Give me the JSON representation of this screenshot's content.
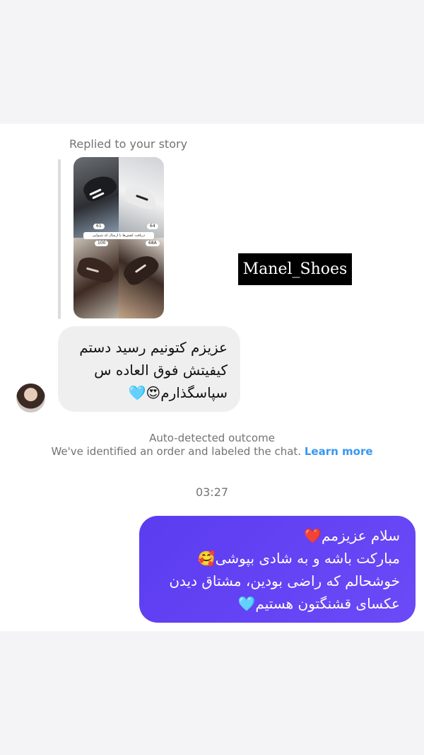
{
  "story_reply": {
    "label": "Replied to your story",
    "story_caption": "دریافت کفش‌ها با ارسال کد شنوایی",
    "tags": [
      "61",
      "64",
      "100",
      "68A"
    ]
  },
  "watermark": "Manel_Shoes",
  "incoming_message": {
    "lines": [
      "عزیزم کتونیم رسید دستم",
      "کیفیتش فوق العاده س",
      "سپاسگذارم😍🩵"
    ]
  },
  "outcome_notice": {
    "title": "Auto-detected outcome",
    "description": "We've identified an order and labeled the chat.",
    "link": "Learn more"
  },
  "timestamp": "03:27",
  "outgoing_message": {
    "lines": [
      "سلام عزیزمم❤️",
      "مبارکت باشه و به شادی بپوشی🥰",
      "خوشحالم که راضی بودین، مشتاق دیدن",
      "عکسای قشنگتون هستیم🩵"
    ]
  }
}
